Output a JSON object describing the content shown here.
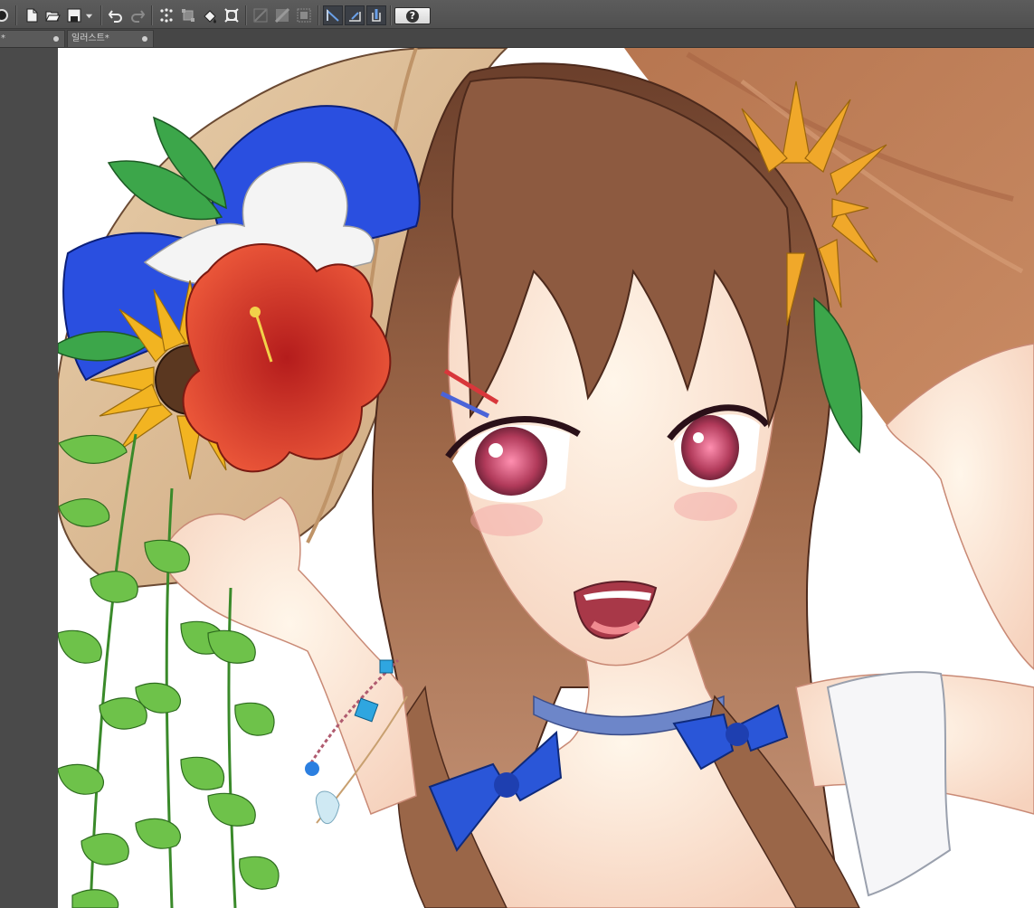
{
  "tabs": [
    {
      "label": "*"
    },
    {
      "label": "일러스트*"
    }
  ],
  "toolbar": {
    "help_label": "?",
    "icons": [
      "new-file-icon",
      "open-file-icon",
      "save-icon",
      "dropdown-arrow-icon",
      "undo-icon",
      "redo-icon",
      "selection-icon",
      "transform-icon",
      "fill-icon",
      "crop-icon",
      "ruler-icon",
      "grid-icon",
      "frame-icon",
      "perspective-ruler-icon",
      "snap-ruler-icon",
      "snap-pen-icon"
    ]
  },
  "colors": {
    "toolbar_bg": "#555555",
    "canvas_bg": "#ffffff",
    "workspace_bg": "#4a4a4a",
    "bow_blue": "#2850e0",
    "hair_brown": "#8a5a3e",
    "hat_straw": "#dfc09a"
  }
}
